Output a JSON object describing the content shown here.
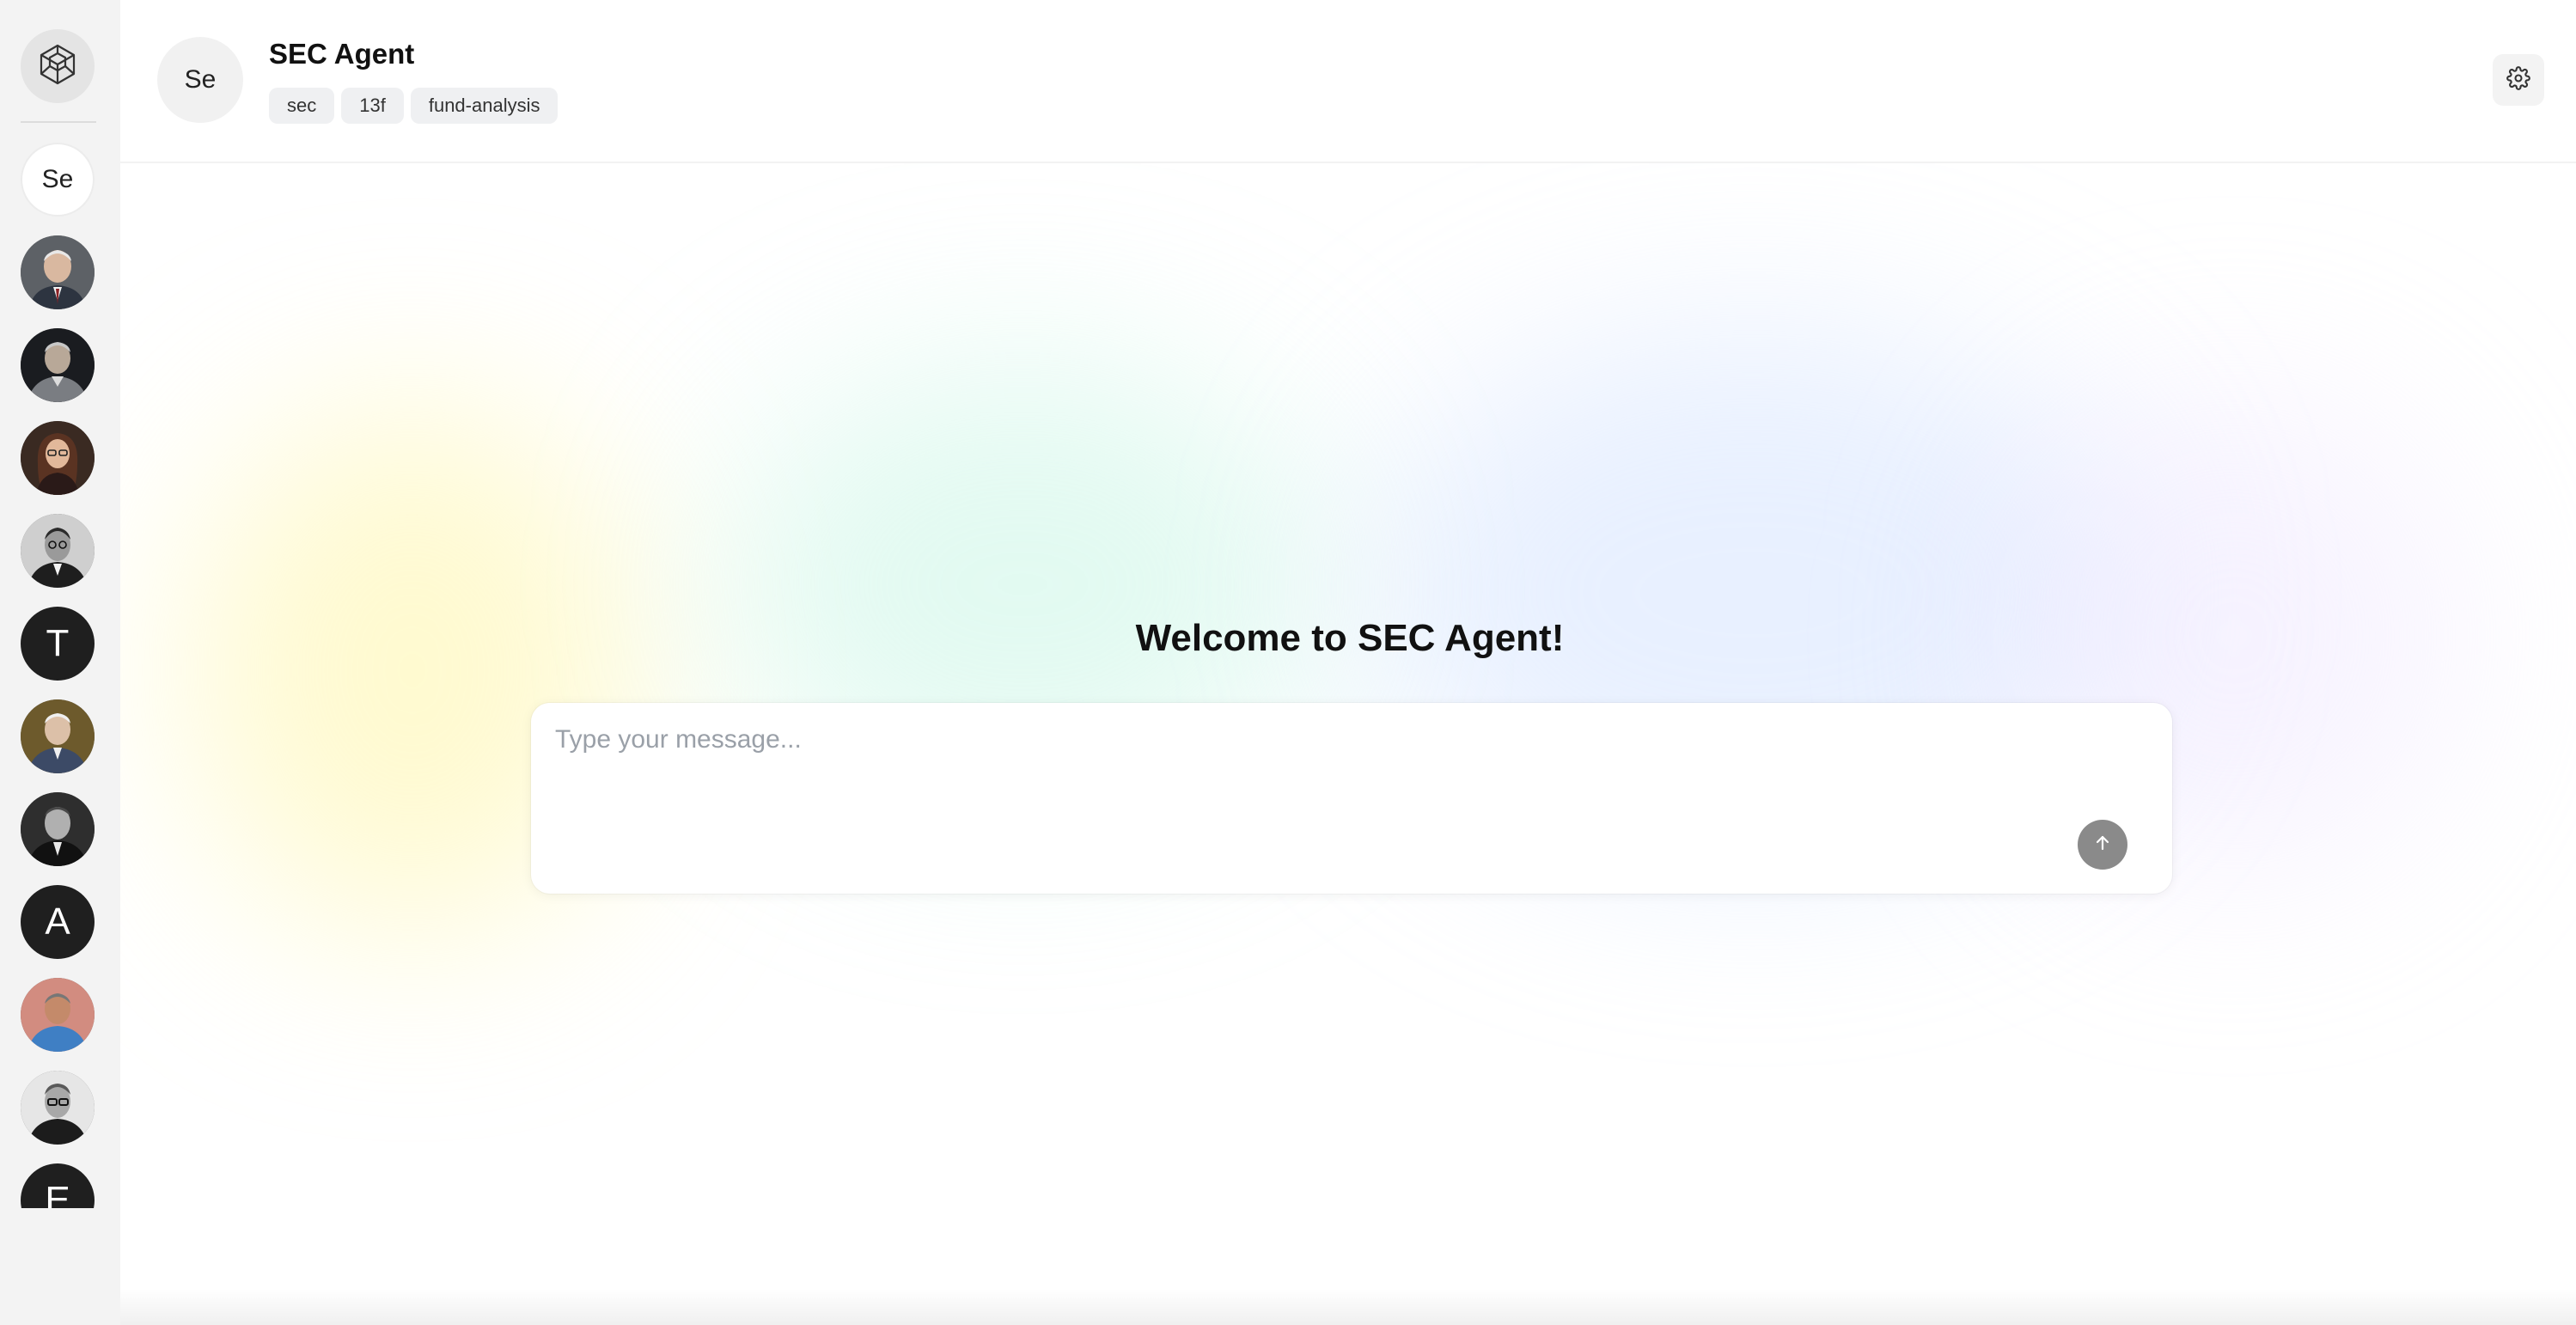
{
  "sidebar": {
    "logo_icon": "cube-network-icon",
    "agents": [
      {
        "kind": "initials",
        "label": "Se",
        "style": "light"
      },
      {
        "kind": "photo",
        "icon": "portrait-avatar"
      },
      {
        "kind": "photo",
        "icon": "portrait-avatar"
      },
      {
        "kind": "photo",
        "icon": "portrait-avatar"
      },
      {
        "kind": "photo",
        "icon": "portrait-avatar"
      },
      {
        "kind": "initials",
        "label": "T",
        "style": "dark"
      },
      {
        "kind": "photo",
        "icon": "portrait-avatar"
      },
      {
        "kind": "photo",
        "icon": "portrait-avatar"
      },
      {
        "kind": "initials",
        "label": "A",
        "style": "dark"
      },
      {
        "kind": "photo",
        "icon": "portrait-avatar"
      },
      {
        "kind": "photo",
        "icon": "portrait-avatar"
      },
      {
        "kind": "initials",
        "label": "E",
        "style": "dark"
      }
    ]
  },
  "header": {
    "avatar_initials": "Se",
    "title": "SEC Agent",
    "tags": [
      "sec",
      "13f",
      "fund-analysis"
    ],
    "settings_icon": "gear-icon"
  },
  "main": {
    "welcome": "Welcome to SEC Agent!",
    "composer": {
      "placeholder": "Type your message...",
      "value": "",
      "send_icon": "arrow-up-icon"
    }
  },
  "colors": {
    "sidebar_bg": "#f3f3f3",
    "dark_avatar": "#1f1f1f",
    "send_button": "#8a8a8a",
    "tag_bg": "#eff0f2"
  }
}
